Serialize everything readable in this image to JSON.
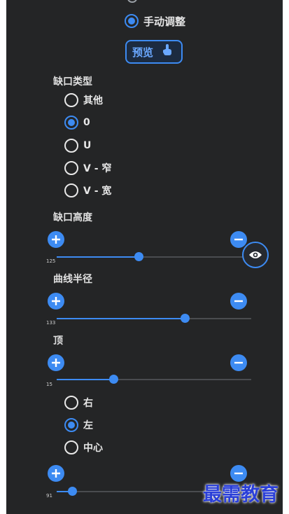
{
  "adjust_mode": {
    "label": "手动调整",
    "selected": true
  },
  "preview_button": {
    "label": "预览",
    "icon": "hand-pointer-icon"
  },
  "notch_type": {
    "title": "缺口类型",
    "options": [
      {
        "label": "其他",
        "selected": false
      },
      {
        "label": "0",
        "selected": true
      },
      {
        "label": "U",
        "selected": false
      },
      {
        "label": "V - 窄",
        "selected": false
      },
      {
        "label": "V - 宽",
        "selected": false
      }
    ]
  },
  "sliders": [
    {
      "title": "缺口高度",
      "value": "125",
      "fraction": 0.42
    },
    {
      "title": "曲线半径",
      "value": "133",
      "fraction": 0.66
    },
    {
      "title": "顶",
      "value": "15",
      "fraction": 0.29
    },
    {
      "title": "",
      "value": "91",
      "fraction": 0.08
    }
  ],
  "position": {
    "options": [
      {
        "label": "右",
        "selected": false
      },
      {
        "label": "左",
        "selected": true
      },
      {
        "label": "中心",
        "selected": false
      }
    ]
  },
  "watermark": "最需教育",
  "colors": {
    "accent": "#3d8bf2",
    "panel": "#242526"
  }
}
